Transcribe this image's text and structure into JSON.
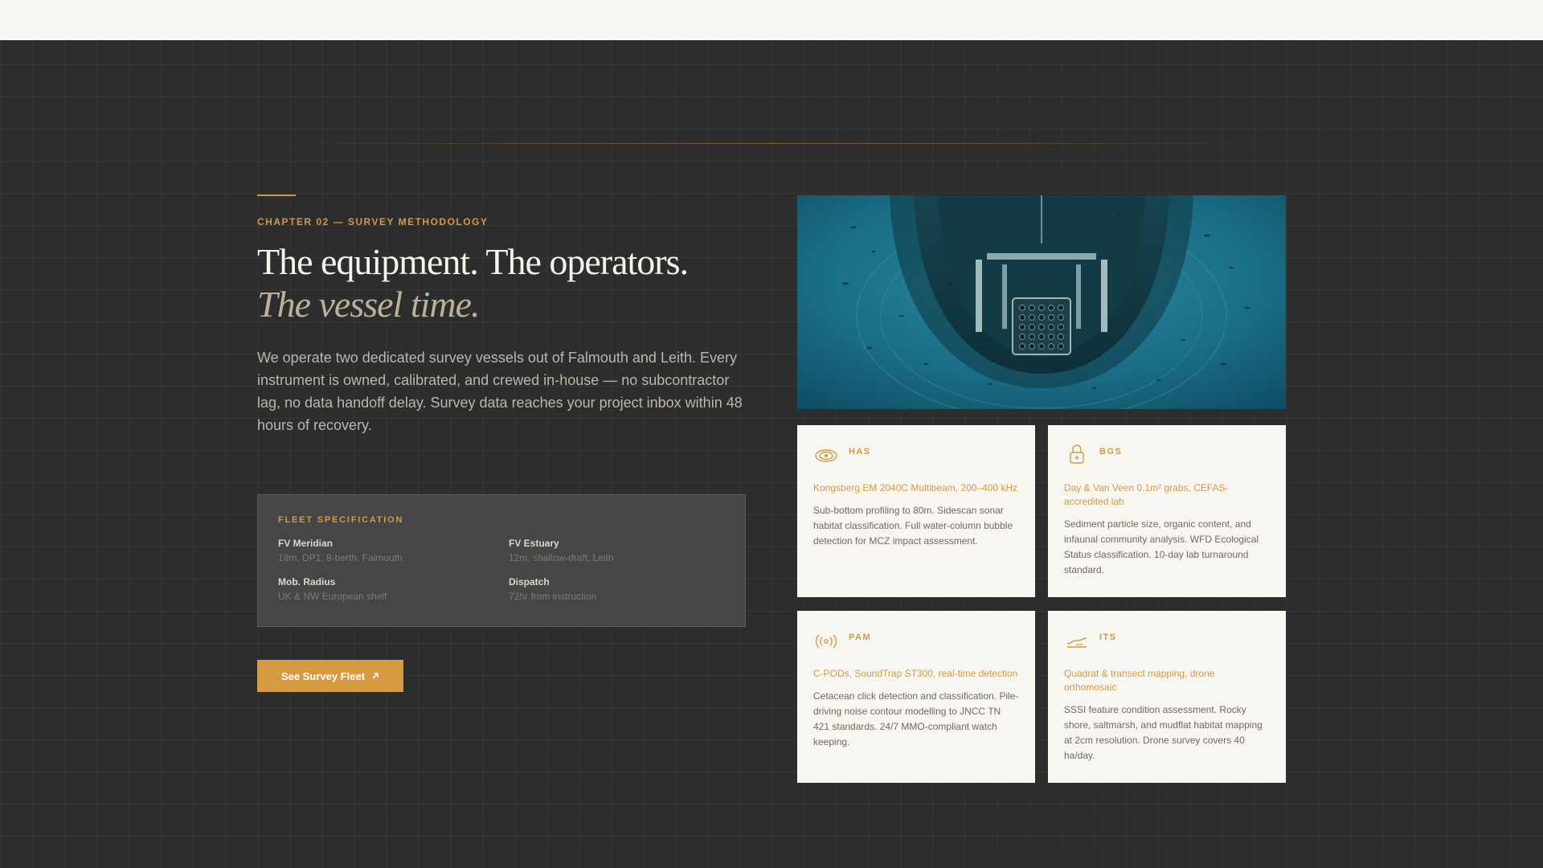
{
  "chapter": {
    "eyebrow": "CHAPTER 02 — SURVEY METHODOLOGY",
    "title_line1": "The equipment. The operators.",
    "title_line2": "The vessel time.",
    "lead": "We operate two dedicated survey vessels out of Falmouth and Leith. Every instrument is owned, calibrated, and crewed in-house — no subcontractor lag, no data handoff delay. Survey data reaches your project inbox within 48 hours of recovery."
  },
  "fleet": {
    "title": "FLEET SPECIFICATION",
    "items": [
      {
        "label": "FV Meridian",
        "value": "18m, DP1, 8-berth, Falmouth"
      },
      {
        "label": "FV Estuary",
        "value": "12m, shallow-draft, Leith"
      },
      {
        "label": "Mob. Radius",
        "value": "UK & NW European shelf"
      },
      {
        "label": "Dispatch",
        "value": "72hr from instruction"
      }
    ]
  },
  "cta": {
    "label": "See Survey Fleet"
  },
  "colors": {
    "accent": "#d19a45",
    "background": "#2d2d2d",
    "card": "#f8f6f0"
  },
  "cards": [
    {
      "code": "HAS",
      "icon": "sonar-icon",
      "spec": "Kongsberg EM 2040C Multibeam, 200–400 kHz",
      "desc": "Sub-bottom profiling to 80m. Sidescan sonar habitat classification. Full water-column bubble detection for MCZ impact assessment."
    },
    {
      "code": "BGS",
      "icon": "sample-jar-icon",
      "spec": "Day & Van Veen 0.1m² grabs, CEFAS-accredited lab",
      "desc": "Sediment particle size, organic content, and infaunal community analysis. WFD Ecological Status classification. 10-day lab turnaround standard."
    },
    {
      "code": "PAM",
      "icon": "acoustic-signal-icon",
      "spec": "C-PODs, SoundTrap ST300, real-time detection",
      "desc": "Cetacean click detection and classification. Pile-driving noise contour modelling to JNCC TN 421 standards. 24/7 MMO-compliant watch keeping."
    },
    {
      "code": "ITS",
      "icon": "shoreline-icon",
      "spec": "Quadrat & transect mapping, drone orthomosaic",
      "desc": "SSSI feature condition assessment. Rocky shore, saltmarsh, and mudflat habitat mapping at 2cm resolution. Drone survey covers 40 ha/day."
    }
  ]
}
